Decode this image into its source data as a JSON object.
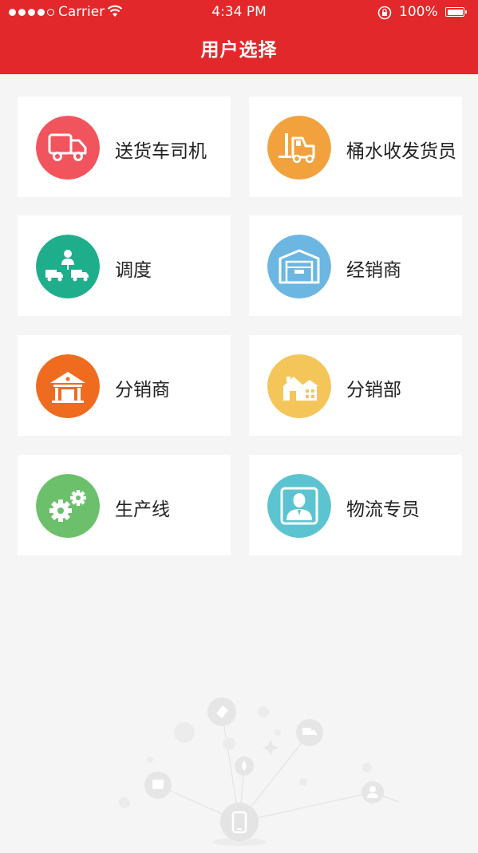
{
  "status_bar": {
    "carrier": "Carrier",
    "time": "4:34 PM",
    "battery": "100%"
  },
  "header": {
    "title": "用户选择",
    "color": "#e2282a"
  },
  "roles": [
    {
      "label": "送货车司机",
      "icon": "delivery-truck-icon",
      "color": "#f1545d"
    },
    {
      "label": "桶水收发货员",
      "icon": "forklift-icon",
      "color": "#f2a23d"
    },
    {
      "label": "调度",
      "icon": "dispatch-icon",
      "color": "#1fae8b"
    },
    {
      "label": "经销商",
      "icon": "warehouse-icon",
      "color": "#6cb6e2"
    },
    {
      "label": "分销商",
      "icon": "store-icon",
      "color": "#ef6b1f"
    },
    {
      "label": "分销部",
      "icon": "house-icon",
      "color": "#f4c65a"
    },
    {
      "label": "生产线",
      "icon": "gears-icon",
      "color": "#6cc06c"
    },
    {
      "label": "物流专员",
      "icon": "person-icon",
      "color": "#5bc4d0"
    }
  ]
}
